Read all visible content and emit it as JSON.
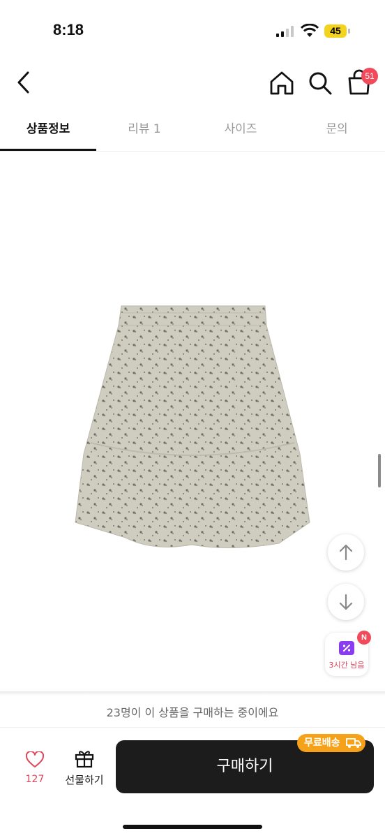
{
  "status_bar": {
    "time": "8:18",
    "battery": "45",
    "icons": [
      "signal-icon",
      "wifi-icon",
      "battery-icon"
    ]
  },
  "header": {
    "icons": [
      "back-icon",
      "home-icon",
      "search-icon",
      "cart-icon"
    ],
    "cart_count": "51"
  },
  "tabs": [
    {
      "label": "상품정보",
      "active": true
    },
    {
      "label": "리뷰 1",
      "active": false
    },
    {
      "label": "사이즈",
      "active": false
    },
    {
      "label": "문의",
      "active": false
    }
  ],
  "floating": {
    "up_icon": "arrow-up-icon",
    "down_icon": "arrow-down-icon",
    "coupon_text": "3시간 남음",
    "coupon_badge": "N"
  },
  "bottom": {
    "buyers_text": "23명이 이 상품을 구매하는 중이에요",
    "like_count": "127",
    "gift_label": "선물하기",
    "buy_label": "구매하기",
    "free_shipping": "무료배송"
  },
  "colors": {
    "accent": "#f04a5b",
    "buy_button": "#1c1c1c",
    "free_shipping": "#f6a11a",
    "coupon": "#8a3df0"
  }
}
